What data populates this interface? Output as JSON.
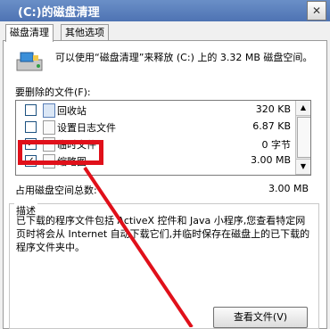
{
  "window": {
    "title": "(C:)的磁盘清理",
    "close_glyph": "✕"
  },
  "tabs": [
    {
      "label": "磁盘清理"
    },
    {
      "label": "其他选项"
    }
  ],
  "intro_text": "可以使用“磁盘清理”来释放 (C:) 上的 3.32 MB 磁盘空间。",
  "files_label": "要删除的文件(F):",
  "files": [
    {
      "name": "回收站",
      "size": "320 KB",
      "checked": false,
      "check_glyph": ""
    },
    {
      "name": "设置日志文件",
      "size": "6.87 KB",
      "checked": false,
      "check_glyph": ""
    },
    {
      "name": "临时文件",
      "size": "0 字节",
      "checked": true,
      "check_glyph": "✓"
    },
    {
      "name": "缩略图",
      "size": "3.00 MB",
      "checked": true,
      "check_glyph": "✓"
    }
  ],
  "scrollbar": {
    "up": "▲",
    "down": "▼"
  },
  "total": {
    "label": "占用磁盘空间总数:",
    "value": "3.00 MB"
  },
  "description": {
    "label": "描述",
    "text": "已下载的程序文件包括 ActiveX 控件和 Java 小程序,您查看特定网页时将会从 Internet 自动下载它们,并临时保存在磁盘上的已下载的程序文件夹中。"
  },
  "view_files_button": "查看文件(V)",
  "colors": {
    "highlight": "#e0101a",
    "titlebar": "#4e73b3"
  }
}
